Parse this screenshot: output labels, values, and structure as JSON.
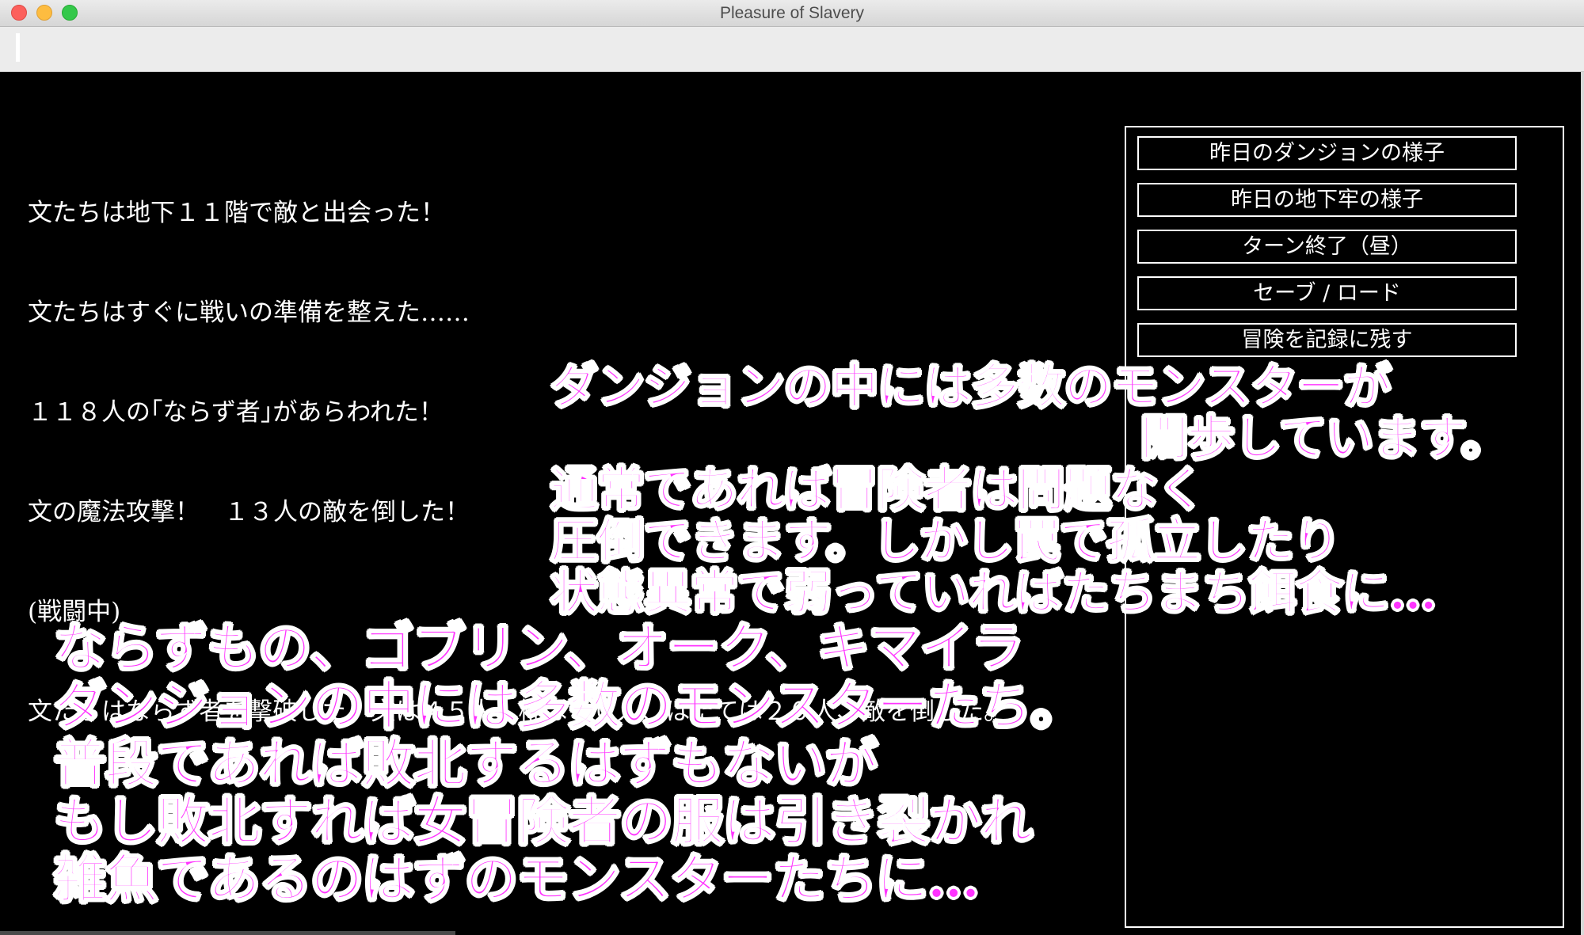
{
  "window": {
    "title": "Pleasure of Slavery"
  },
  "log": [
    "文たちは地下１１階で敵と出会った！",
    "文たちはすぐに戦いの準備を整えた……",
    "１１８人の｢ならず者｣があらわれた！",
    "文の魔法攻撃！　１３人の敵を倒した！",
    "(戦闘中)",
    "文たちはならず者を撃破した。文は４５人、椛は４０人、はたては２０人、敵を倒した。"
  ],
  "menu": [
    "昨日のダンジョンの様子",
    "昨日の地下牢の様子",
    "ターン終了（昼）",
    "セーブ / ロード",
    "冒険を記録に残す"
  ],
  "overlay_upper": [
    "ダンジョンの中には多数のモンスターが",
    "闊歩しています。",
    "通常であれば冒険者は問題なく",
    "圧倒できます。しかし罠で孤立したり",
    "状態異常で弱っていればたちまち餌食に…"
  ],
  "overlay_lower": [
    "ならずもの、ゴブリン、オーク、キマイラ",
    "ダンジョンの中には多数のモンスターたち。",
    "普段であれば敗北するはずもないが",
    "もし敗北すれば女冒険者の服は引き裂かれ",
    "雑魚であるのはずのモンスターたちに…"
  ],
  "colors": {
    "background": "#000000",
    "overlay_fill": "#ff33ff",
    "overlay_outline": "#ffffff",
    "log_text": "#ffffff"
  }
}
